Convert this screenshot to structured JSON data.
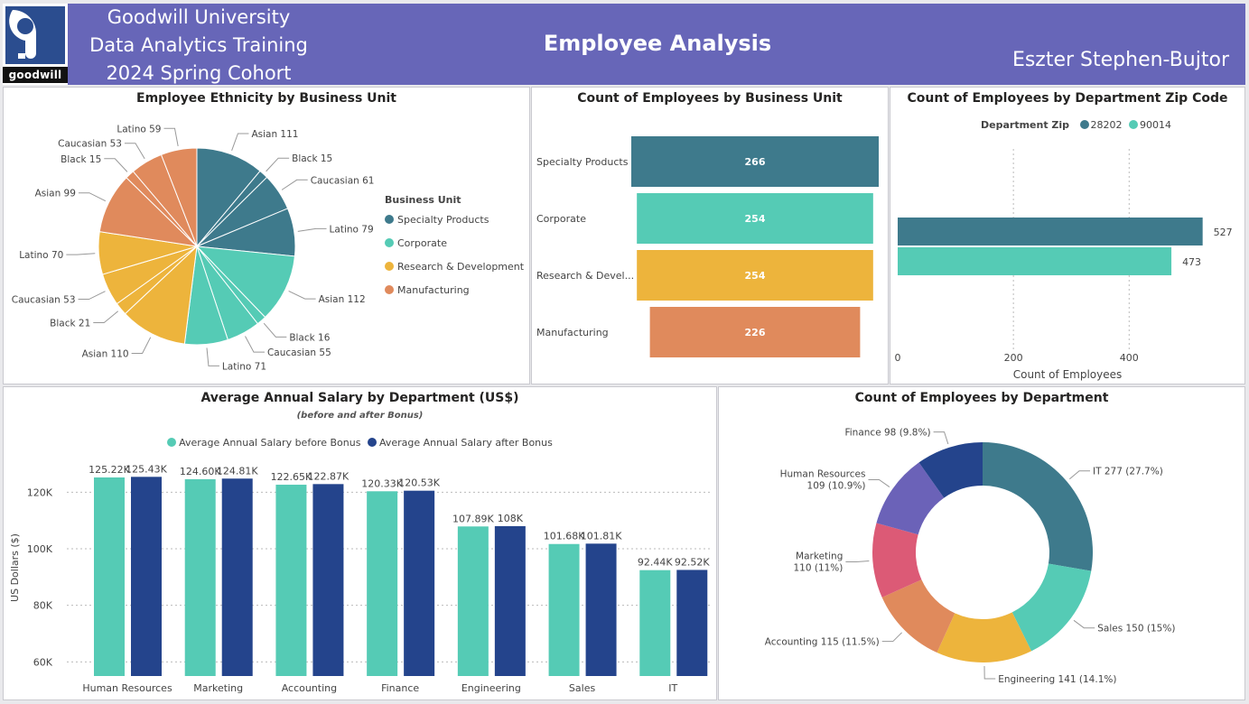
{
  "header": {
    "logo_text": "goodwill",
    "org_lines": [
      "Goodwill University",
      "Data Analytics Training",
      "2024 Spring Cohort"
    ],
    "title": "Employee Analysis",
    "author": "Eszter Stephen-Bujtor"
  },
  "colors": {
    "specialty": "#3e7a8c",
    "corporate": "#55cbb5",
    "rnd": "#edb43c",
    "manufacturing": "#e08a5c",
    "zip28202": "#3e7a8c",
    "zip90014": "#55cbb5",
    "before_bonus": "#55cbb5",
    "after_bonus": "#24448c",
    "dept_it": "#3e7a8c",
    "dept_sales": "#55cbb5",
    "dept_engineering": "#edb43c",
    "dept_accounting": "#e08a5c",
    "dept_marketing": "#dc5a76",
    "dept_hr": "#6b62b8",
    "dept_finance": "#24448c"
  },
  "ethnicity_pie": {
    "title": "Employee Ethnicity by Business Unit",
    "legend_title": "Business Unit",
    "legend": [
      "Specialty Products",
      "Corporate",
      "Research & Development",
      "Manufacturing"
    ]
  },
  "bu_bars": {
    "title": "Count of Employees by Business Unit"
  },
  "zip_bars": {
    "title": "Count of Employees by Department Zip Code",
    "legend_title": "Department Zip",
    "legend": [
      "28202",
      "90014"
    ],
    "xlabel": "Count of Employees",
    "ticks": [
      "0",
      "200",
      "400"
    ]
  },
  "salary": {
    "title": "Average Annual Salary by Department (US$)",
    "subtitle": "(before and after Bonus)",
    "legend": [
      "Average Annual Salary before Bonus",
      "Average Annual Salary after Bonus"
    ],
    "ylabel": "US Dollars ($)",
    "yticks": [
      "60K",
      "80K",
      "100K",
      "120K"
    ]
  },
  "dept_donut": {
    "title": "Count of Employees by Department"
  },
  "chart_data": [
    {
      "type": "pie",
      "title": "Employee Ethnicity by Business Unit",
      "series_name": "Business Unit",
      "slices": [
        {
          "unit": "Specialty Products",
          "label": "Asian",
          "value": 111,
          "text": "Asian 111"
        },
        {
          "unit": "Specialty Products",
          "label": "Black",
          "value": 15,
          "text": "Black 15"
        },
        {
          "unit": "Specialty Products",
          "label": "Caucasian",
          "value": 61,
          "text": "Caucasian 61"
        },
        {
          "unit": "Specialty Products",
          "label": "Latino",
          "value": 79,
          "text": "Latino 79"
        },
        {
          "unit": "Corporate",
          "label": "Asian",
          "value": 112,
          "text": "Asian 112"
        },
        {
          "unit": "Corporate",
          "label": "Black",
          "value": 16,
          "text": "Black 16"
        },
        {
          "unit": "Corporate",
          "label": "Caucasian",
          "value": 55,
          "text": "Caucasian 55"
        },
        {
          "unit": "Corporate",
          "label": "Latino",
          "value": 71,
          "text": "Latino 71"
        },
        {
          "unit": "Research & Development",
          "label": "Asian",
          "value": 110,
          "text": "Asian 110"
        },
        {
          "unit": "Research & Development",
          "label": "Black",
          "value": 21,
          "text": "Black 21"
        },
        {
          "unit": "Research & Development",
          "label": "Caucasian",
          "value": 53,
          "text": "Caucasian 53"
        },
        {
          "unit": "Research & Development",
          "label": "Latino",
          "value": 70,
          "text": "Latino 70"
        },
        {
          "unit": "Manufacturing",
          "label": "Asian",
          "value": 99,
          "text": "Asian 99"
        },
        {
          "unit": "Manufacturing",
          "label": "Black",
          "value": 15,
          "text": "Black 15"
        },
        {
          "unit": "Manufacturing",
          "label": "Caucasian",
          "value": 53,
          "text": "Caucasian 53"
        },
        {
          "unit": "Manufacturing",
          "label": "Latino",
          "value": 59,
          "text": "Latino 59"
        }
      ]
    },
    {
      "type": "bar",
      "title": "Count of Employees by Business Unit",
      "categories": [
        "Specialty Products",
        "Corporate",
        "Research & Devel...",
        "Manufacturing"
      ],
      "values": [
        266,
        254,
        254,
        226
      ]
    },
    {
      "type": "bar",
      "title": "Count of Employees by Department Zip Code",
      "xlabel": "Count of Employees",
      "xlim": [
        0,
        540
      ],
      "series": [
        {
          "name": "28202",
          "values": [
            527
          ]
        },
        {
          "name": "90014",
          "values": [
            473
          ]
        }
      ]
    },
    {
      "type": "bar",
      "title": "Average Annual Salary by Department (US$)",
      "ylabel": "US Dollars ($)",
      "ylim": [
        55000,
        130000
      ],
      "categories": [
        "Human Resources",
        "Marketing",
        "Accounting",
        "Finance",
        "Engineering",
        "Sales",
        "IT"
      ],
      "series": [
        {
          "name": "Average Annual Salary before Bonus",
          "values": [
            125220,
            124600,
            122650,
            120330,
            107890,
            101680,
            92440
          ],
          "labels": [
            "125.22K",
            "124.60K",
            "122.65K",
            "120.33K",
            "107.89K",
            "101.68K",
            "92.44K"
          ]
        },
        {
          "name": "Average Annual Salary after Bonus",
          "values": [
            125430,
            124810,
            122870,
            120530,
            108000,
            101810,
            92520
          ],
          "labels": [
            "125.43K",
            "124.81K",
            "122.87K",
            "120.53K",
            "108K",
            "101.81K",
            "92.52K"
          ]
        }
      ]
    },
    {
      "type": "pie",
      "title": "Count of Employees by Department",
      "slices": [
        {
          "label": "IT",
          "value": 277,
          "text": "IT 277 (27.7%)"
        },
        {
          "label": "Sales",
          "value": 150,
          "text": "Sales 150 (15%)"
        },
        {
          "label": "Engineering",
          "value": 141,
          "text": "Engineering 141 (14.1%)"
        },
        {
          "label": "Accounting",
          "value": 115,
          "text": "Accounting 115 (11.5%)"
        },
        {
          "label": "Marketing",
          "value": 110,
          "text": "Marketing 110 (11%)"
        },
        {
          "label": "Human Resources",
          "value": 109,
          "text": "Human Resources 109 (10.9%)"
        },
        {
          "label": "Finance",
          "value": 98,
          "text": "Finance 98 (9.8%)"
        }
      ]
    }
  ]
}
